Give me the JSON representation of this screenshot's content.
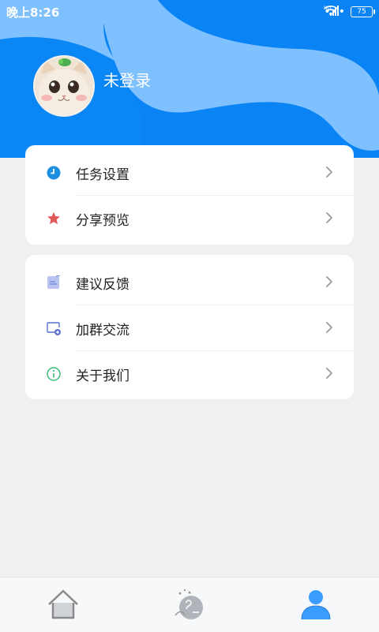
{
  "status": {
    "time": "晚上8:26",
    "network": "HD",
    "battery": "75"
  },
  "profile": {
    "login_label": "未登录"
  },
  "menu_group_1": [
    {
      "label": "任务设置",
      "icon": "clock-icon"
    },
    {
      "label": "分享预览",
      "icon": "star-icon"
    }
  ],
  "menu_group_2": [
    {
      "label": "建议反馈",
      "icon": "feedback-icon"
    },
    {
      "label": "加群交流",
      "icon": "add-group-icon"
    },
    {
      "label": "关于我们",
      "icon": "info-icon"
    }
  ],
  "tabbar": {
    "items": [
      "home-icon",
      "dream-icon",
      "profile-icon"
    ],
    "active_index": 2
  },
  "colors": {
    "header_blue": "#0a83f5",
    "header_light": "#7fc0ff",
    "active_tab": "#3b9cff"
  }
}
